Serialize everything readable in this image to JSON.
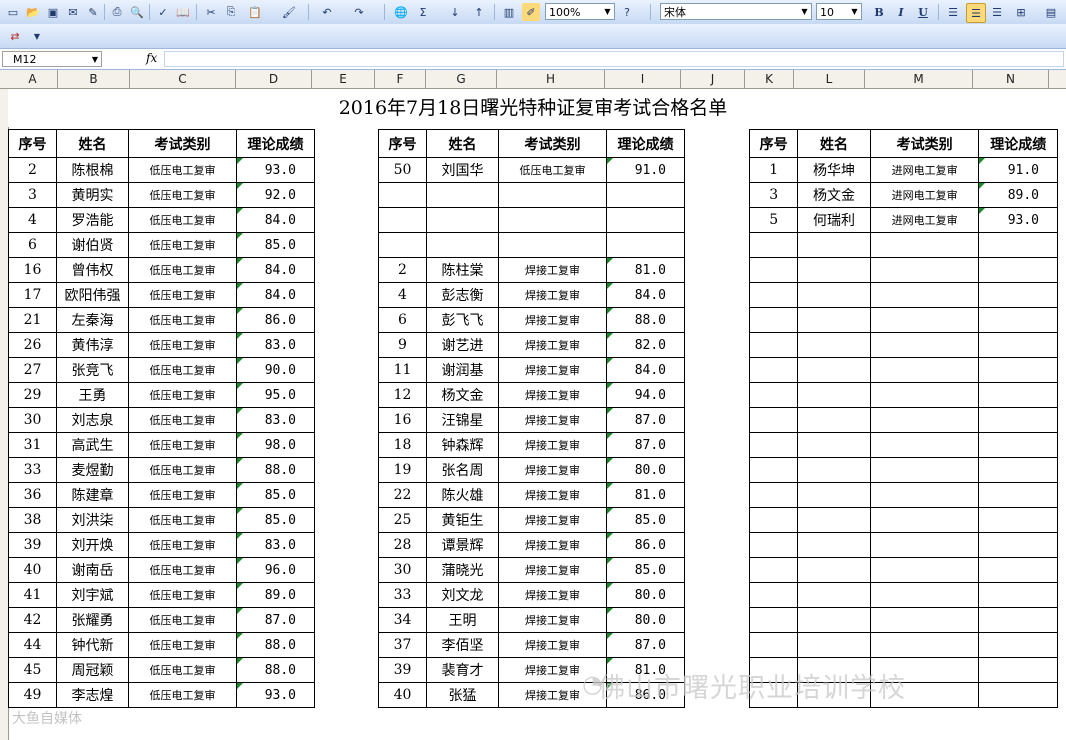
{
  "toolbar": {
    "zoom": "100%",
    "font_name": "宋体",
    "font_size": "10",
    "bold": "B",
    "italic": "I",
    "underline": "U",
    "sigma": "Σ"
  },
  "formula_bar": {
    "cell_ref": "M12",
    "fx": "fx",
    "value": ""
  },
  "columns": [
    "A",
    "B",
    "C",
    "D",
    "E",
    "F",
    "G",
    "H",
    "I",
    "J",
    "K",
    "L",
    "M",
    "N"
  ],
  "sheet": {
    "title": "2016年7月18日曙光特种证复审考试合格名单",
    "headers": [
      "序号",
      "姓名",
      "考试类别",
      "理论成绩"
    ]
  },
  "table1": [
    {
      "no": "2",
      "name": "陈根棉",
      "cat": "低压电工复审",
      "score": "93.0"
    },
    {
      "no": "3",
      "name": "黄明实",
      "cat": "低压电工复审",
      "score": "92.0"
    },
    {
      "no": "4",
      "name": "罗浩能",
      "cat": "低压电工复审",
      "score": "84.0"
    },
    {
      "no": "6",
      "name": "谢伯贤",
      "cat": "低压电工复审",
      "score": "85.0"
    },
    {
      "no": "16",
      "name": "曾伟权",
      "cat": "低压电工复审",
      "score": "84.0"
    },
    {
      "no": "17",
      "name": "欧阳伟强",
      "cat": "低压电工复审",
      "score": "84.0"
    },
    {
      "no": "21",
      "name": "左秦海",
      "cat": "低压电工复审",
      "score": "86.0"
    },
    {
      "no": "26",
      "name": "黄伟淳",
      "cat": "低压电工复审",
      "score": "83.0"
    },
    {
      "no": "27",
      "name": "张竞飞",
      "cat": "低压电工复审",
      "score": "90.0"
    },
    {
      "no": "29",
      "name": "王勇",
      "cat": "低压电工复审",
      "score": "95.0"
    },
    {
      "no": "30",
      "name": "刘志泉",
      "cat": "低压电工复审",
      "score": "83.0"
    },
    {
      "no": "31",
      "name": "高武生",
      "cat": "低压电工复审",
      "score": "98.0"
    },
    {
      "no": "33",
      "name": "麦煜勤",
      "cat": "低压电工复审",
      "score": "88.0"
    },
    {
      "no": "36",
      "name": "陈建章",
      "cat": "低压电工复审",
      "score": "85.0"
    },
    {
      "no": "38",
      "name": "刘洪柒",
      "cat": "低压电工复审",
      "score": "85.0"
    },
    {
      "no": "39",
      "name": "刘开焕",
      "cat": "低压电工复审",
      "score": "83.0"
    },
    {
      "no": "40",
      "name": "谢南岳",
      "cat": "低压电工复审",
      "score": "96.0"
    },
    {
      "no": "41",
      "name": "刘宇斌",
      "cat": "低压电工复审",
      "score": "89.0"
    },
    {
      "no": "42",
      "name": "张耀勇",
      "cat": "低压电工复审",
      "score": "87.0"
    },
    {
      "no": "44",
      "name": "钟代新",
      "cat": "低压电工复审",
      "score": "88.0"
    },
    {
      "no": "45",
      "name": "周冠颖",
      "cat": "低压电工复审",
      "score": "88.0"
    },
    {
      "no": "49",
      "name": "李志煌",
      "cat": "低压电工复审",
      "score": "93.0"
    }
  ],
  "table2": [
    {
      "no": "50",
      "name": "刘国华",
      "cat": "低压电工复审",
      "score": "91.0"
    },
    {
      "no": "",
      "name": "",
      "cat": "",
      "score": ""
    },
    {
      "no": "",
      "name": "",
      "cat": "",
      "score": ""
    },
    {
      "no": "",
      "name": "",
      "cat": "",
      "score": ""
    },
    {
      "no": "2",
      "name": "陈柱棠",
      "cat": "焊接工复审",
      "score": "81.0"
    },
    {
      "no": "4",
      "name": "彭志衡",
      "cat": "焊接工复审",
      "score": "84.0"
    },
    {
      "no": "6",
      "name": "彭飞飞",
      "cat": "焊接工复审",
      "score": "88.0"
    },
    {
      "no": "9",
      "name": "谢艺进",
      "cat": "焊接工复审",
      "score": "82.0"
    },
    {
      "no": "11",
      "name": "谢润基",
      "cat": "焊接工复审",
      "score": "84.0"
    },
    {
      "no": "12",
      "name": "杨文金",
      "cat": "焊接工复审",
      "score": "94.0"
    },
    {
      "no": "16",
      "name": "汪锦星",
      "cat": "焊接工复审",
      "score": "87.0"
    },
    {
      "no": "18",
      "name": "钟森辉",
      "cat": "焊接工复审",
      "score": "87.0"
    },
    {
      "no": "19",
      "name": "张名周",
      "cat": "焊接工复审",
      "score": "80.0"
    },
    {
      "no": "22",
      "name": "陈火雄",
      "cat": "焊接工复审",
      "score": "81.0"
    },
    {
      "no": "25",
      "name": "黄钜生",
      "cat": "焊接工复审",
      "score": "85.0"
    },
    {
      "no": "28",
      "name": "谭景辉",
      "cat": "焊接工复审",
      "score": "86.0"
    },
    {
      "no": "30",
      "name": "蒲晓光",
      "cat": "焊接工复审",
      "score": "85.0"
    },
    {
      "no": "33",
      "name": "刘文龙",
      "cat": "焊接工复审",
      "score": "80.0"
    },
    {
      "no": "34",
      "name": "王明",
      "cat": "焊接工复审",
      "score": "80.0"
    },
    {
      "no": "37",
      "name": "李佰坚",
      "cat": "焊接工复审",
      "score": "87.0"
    },
    {
      "no": "39",
      "name": "裴育才",
      "cat": "焊接工复审",
      "score": "81.0"
    },
    {
      "no": "40",
      "name": "张猛",
      "cat": "焊接工复审",
      "score": "86.0"
    }
  ],
  "table3": [
    {
      "no": "1",
      "name": "杨华坤",
      "cat": "进网电工复审",
      "score": "91.0"
    },
    {
      "no": "3",
      "name": "杨文金",
      "cat": "进网电工复审",
      "score": "89.0"
    },
    {
      "no": "5",
      "name": "何瑞利",
      "cat": "进网电工复审",
      "score": "93.0"
    },
    {
      "no": "",
      "name": "",
      "cat": "",
      "score": ""
    },
    {
      "no": "",
      "name": "",
      "cat": "",
      "score": ""
    },
    {
      "no": "",
      "name": "",
      "cat": "",
      "score": ""
    },
    {
      "no": "",
      "name": "",
      "cat": "",
      "score": ""
    },
    {
      "no": "",
      "name": "",
      "cat": "",
      "score": ""
    },
    {
      "no": "",
      "name": "",
      "cat": "",
      "score": ""
    },
    {
      "no": "",
      "name": "",
      "cat": "",
      "score": ""
    },
    {
      "no": "",
      "name": "",
      "cat": "",
      "score": ""
    },
    {
      "no": "",
      "name": "",
      "cat": "",
      "score": ""
    },
    {
      "no": "",
      "name": "",
      "cat": "",
      "score": ""
    },
    {
      "no": "",
      "name": "",
      "cat": "",
      "score": ""
    },
    {
      "no": "",
      "name": "",
      "cat": "",
      "score": ""
    },
    {
      "no": "",
      "name": "",
      "cat": "",
      "score": ""
    },
    {
      "no": "",
      "name": "",
      "cat": "",
      "score": ""
    },
    {
      "no": "",
      "name": "",
      "cat": "",
      "score": ""
    },
    {
      "no": "",
      "name": "",
      "cat": "",
      "score": ""
    },
    {
      "no": "",
      "name": "",
      "cat": "",
      "score": ""
    },
    {
      "no": "",
      "name": "",
      "cat": "",
      "score": ""
    },
    {
      "no": "",
      "name": "",
      "cat": "",
      "score": ""
    }
  ],
  "watermark": {
    "main": "佛山市曙光职业培训学校",
    "corner": "大鱼自媒体"
  }
}
